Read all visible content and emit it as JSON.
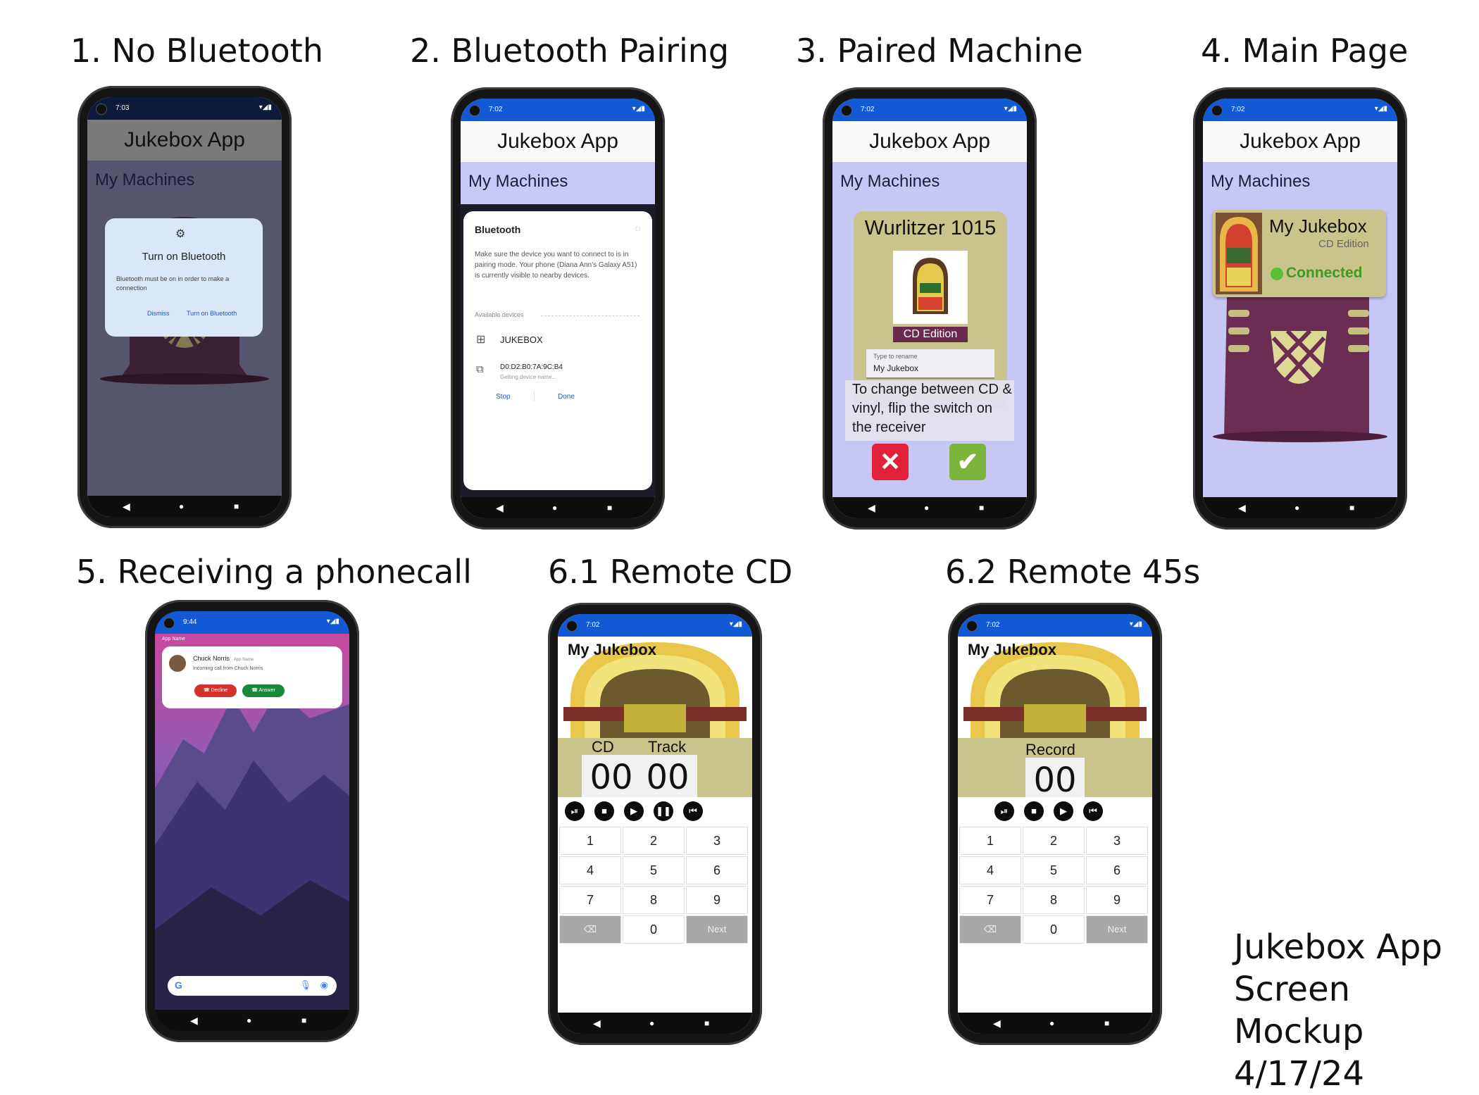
{
  "labels": {
    "s1": "1. No Bluetooth",
    "s2": "2. Bluetooth Pairing",
    "s3": "3. Paired Machine",
    "s4": "4. Main Page",
    "s5": "5. Receiving a phonecall",
    "s61": "6.1 Remote CD",
    "s62": "6.2 Remote 45s"
  },
  "footer": {
    "line1": "Jukebox App",
    "line2": "Screen Mockup",
    "line3": "4/17/24"
  },
  "app": {
    "title": "Jukebox App",
    "section": "My Machines"
  },
  "status": {
    "t1": "7:03",
    "t2": "7:02",
    "t5": "9:44",
    "icons": "▾◢▮"
  },
  "nav": {
    "back": "◀",
    "home": "●",
    "recent": "■"
  },
  "screen1": {
    "dialog_title": "Turn on Bluetooth",
    "dialog_body": "Bluetooth must be on in order to make a connection",
    "dismiss": "Dismiss",
    "turn_on": "Turn on Bluetooth"
  },
  "screen2": {
    "title": "Bluetooth",
    "body": "Make sure the device you want to connect to is in pairing mode. Your phone (Diana Ann's Galaxy A51) is currently visible to nearby devices.",
    "available": "Available devices",
    "device1": "JUKEBOX",
    "device2": "D0:D2:B0:7A:9C:B4",
    "device2_sub": "Getting device name...",
    "stop": "Stop",
    "done": "Done"
  },
  "screen3": {
    "machine": "Wurlitzer 1015",
    "edition": "CD Edition",
    "rename_hint": "Type to rename",
    "rename_value": "My Jukebox",
    "instructions": "To change between CD & vinyl, flip the switch on the receiver"
  },
  "screen4": {
    "name": "My Jukebox",
    "edition": "CD Edition",
    "status": "Connected"
  },
  "screen5": {
    "app_name": "App Name",
    "caller": "Chuck Norris",
    "caller_app": "App Name",
    "message": "Incoming call from Chuck Norris",
    "decline": "Decline",
    "answer": "Answer"
  },
  "remote": {
    "title": "My Jukebox",
    "cd_label": "CD",
    "track_label": "Track",
    "record_label": "Record",
    "cd_value": "00",
    "track_value": "00",
    "record_value": "00",
    "keys": [
      "1",
      "2",
      "3",
      "4",
      "5",
      "6",
      "7",
      "8",
      "9",
      "",
      "0",
      "Next"
    ]
  }
}
